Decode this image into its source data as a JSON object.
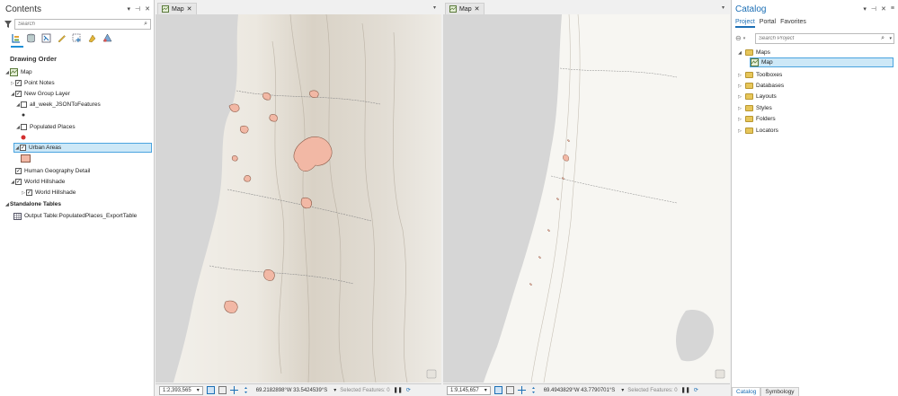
{
  "contents": {
    "title": "Contents",
    "search_placeholder": "Search",
    "section_title": "Drawing Order",
    "items": [
      {
        "label": "Map"
      },
      {
        "label": "Point Notes"
      },
      {
        "label": "New Group Layer"
      },
      {
        "label": "all_week_JSONToFeatures"
      },
      {
        "label": "Populated Places"
      },
      {
        "label": "Urban Areas"
      },
      {
        "label": "Human Geography Detail"
      },
      {
        "label": "World Hillshade"
      },
      {
        "label": "World Hillshade"
      }
    ],
    "standalone_heading": "Standalone Tables",
    "standalone_table": "Output Table:PopulatedPlaces_ExportTable"
  },
  "colors": {
    "urban_fill": "#f2b8a5",
    "urban_stroke": "#8c5a48",
    "point_red": "#d32f2f",
    "accent_blue": "#1c6fb5",
    "selection_fill": "#cde8f7",
    "water_gray": "#d6d6d6",
    "land": "#f7f6f2"
  },
  "maps": [
    {
      "tab_label": "Map",
      "scale": "1:2,393,565",
      "coords": "69.2182898°W 33.5424539°S",
      "selected_features": "Selected Features: 0"
    },
    {
      "tab_label": "Map",
      "scale": "1:9,145,657",
      "coords": "69.4943829°W 43.7790701°S",
      "selected_features": "Selected Features: 0"
    }
  ],
  "catalog": {
    "title": "Catalog",
    "tabs": [
      "Project",
      "Portal",
      "Favorites"
    ],
    "search_placeholder": "Search Project",
    "items": [
      {
        "label": "Maps"
      },
      {
        "label": "Map"
      },
      {
        "label": "Toolboxes"
      },
      {
        "label": "Databases"
      },
      {
        "label": "Layouts"
      },
      {
        "label": "Styles"
      },
      {
        "label": "Folders"
      },
      {
        "label": "Locators"
      }
    ],
    "bottom_tabs": [
      "Catalog",
      "Symbology"
    ]
  },
  "icons": {
    "pane_pin": "pin-icon",
    "pane_close": "close-icon",
    "pane_menu": "menu-icon",
    "filter": "filter-icon",
    "search": "search-icon",
    "map_layer": "map-icon",
    "table": "table-icon",
    "folder": "folder-icon",
    "pause": "pause-icon",
    "refresh": "refresh-icon"
  }
}
